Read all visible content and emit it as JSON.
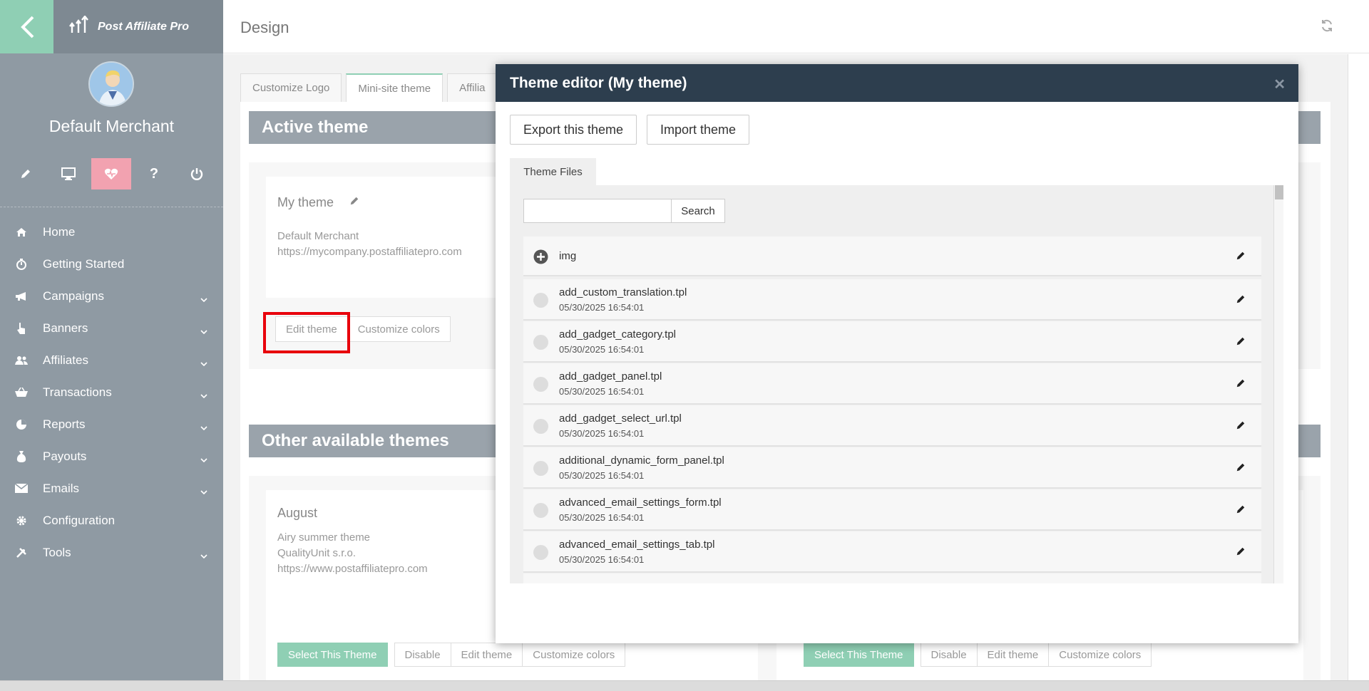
{
  "app": {
    "brand": "Post Affiliate Pro",
    "page_title": "Design"
  },
  "sidebar": {
    "merchant_name": "Default Merchant",
    "toolbar_icons": [
      "pencil-icon",
      "monitor-icon",
      "heart-pulse-icon",
      "help-icon",
      "power-icon"
    ],
    "items": [
      {
        "label": "Home",
        "icon": "home-icon",
        "has_submenu": false
      },
      {
        "label": "Getting Started",
        "icon": "stopwatch-icon",
        "has_submenu": false
      },
      {
        "label": "Campaigns",
        "icon": "megaphone-icon",
        "has_submenu": true
      },
      {
        "label": "Banners",
        "icon": "pointer-hand-icon",
        "has_submenu": true
      },
      {
        "label": "Affiliates",
        "icon": "users-icon",
        "has_submenu": true
      },
      {
        "label": "Transactions",
        "icon": "basket-icon",
        "has_submenu": true
      },
      {
        "label": "Reports",
        "icon": "pie-chart-icon",
        "has_submenu": true
      },
      {
        "label": "Payouts",
        "icon": "money-bag-icon",
        "has_submenu": true
      },
      {
        "label": "Emails",
        "icon": "envelope-icon",
        "has_submenu": true
      },
      {
        "label": "Configuration",
        "icon": "gear-icon",
        "has_submenu": false
      },
      {
        "label": "Tools",
        "icon": "tools-icon",
        "has_submenu": true
      }
    ]
  },
  "tabs": [
    {
      "label": "Customize Logo",
      "active": false
    },
    {
      "label": "Mini-site theme",
      "active": true
    },
    {
      "label": "Affilia",
      "active": false
    }
  ],
  "active_theme": {
    "section_title": "Active theme",
    "name": "My theme",
    "author": "Default Merchant",
    "url": "https://mycompany.postaffiliatepro.com",
    "edit_label": "Edit theme",
    "customize_label": "Customize colors"
  },
  "other_themes": {
    "section_title": "Other available themes",
    "themes": [
      {
        "name": "August",
        "description": "Airy summer theme",
        "author": "QualityUnit s.r.o.",
        "url": "https://www.postaffiliatepro.com",
        "select_label": "Select This Theme",
        "disable_label": "Disable",
        "edit_label": "Edit theme",
        "customize_label": "Customize colors"
      },
      {
        "select_label": "Select This Theme",
        "disable_label": "Disable",
        "edit_label": "Edit theme",
        "customize_label": "Customize colors"
      }
    ]
  },
  "modal": {
    "title": "Theme editor (My theme)",
    "export_label": "Export this theme",
    "import_label": "Import theme",
    "files_tab": "Theme Files",
    "search_label": "Search",
    "search_value": "",
    "folder": {
      "name": "img"
    },
    "files": [
      {
        "name": "add_custom_translation.tpl",
        "date": "05/30/2025 16:54:01"
      },
      {
        "name": "add_gadget_category.tpl",
        "date": "05/30/2025 16:54:01"
      },
      {
        "name": "add_gadget_panel.tpl",
        "date": "05/30/2025 16:54:01"
      },
      {
        "name": "add_gadget_select_url.tpl",
        "date": "05/30/2025 16:54:01"
      },
      {
        "name": "additional_dynamic_form_panel.tpl",
        "date": "05/30/2025 16:54:01"
      },
      {
        "name": "advanced_email_settings_form.tpl",
        "date": "05/30/2025 16:54:01"
      },
      {
        "name": "advanced_email_settings_tab.tpl",
        "date": "05/30/2025 16:54:01"
      }
    ]
  },
  "colors": {
    "sidebar_bg": "#8f9aa3",
    "accent_green": "#8fcfb4",
    "active_icon_pink": "#f2a2b0",
    "modal_header": "#2d3e4e",
    "highlight_red": "#e8000b"
  }
}
